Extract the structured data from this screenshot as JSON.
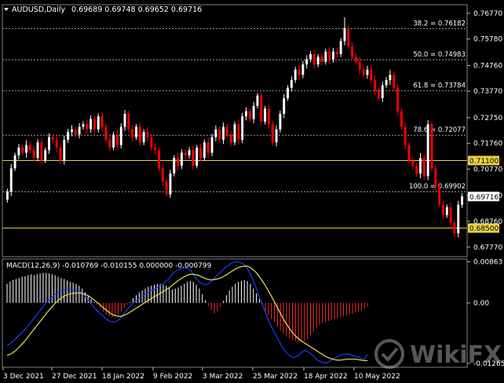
{
  "header": {
    "symbol": "AUDUSD,Daily",
    "ohlc": "0.69689 0.69748 0.69652 0.69716"
  },
  "macd_header": "MACD(12,26,9) -0.010769 -0.010155 0.000000 -0.000799",
  "watermark": "WikiFX",
  "colors": {
    "background": "#000000",
    "bull": "#ffffff",
    "bear": "#ff0000",
    "grid": "#c8c8c8",
    "sr_line": "#e8d24a",
    "macd_line": "#1a3cff",
    "signal_line": "#e8e05a",
    "hist_up": "#ffffff",
    "hist_down": "#ff2a2a"
  },
  "chart_data": {
    "type": "candlestick",
    "price_axis": {
      "ticks": [
        "0.76770",
        "0.75780",
        "0.74760",
        "0.73770",
        "0.72750",
        "0.71760",
        "0.70770",
        "0.69750",
        "0.68760",
        "0.67770"
      ],
      "range": [
        0.674,
        0.771
      ]
    },
    "date_axis": [
      "3 Dec 2021",
      "27 Dec 2021",
      "18 Jan 2022",
      "9 Feb 2022",
      "3 Mar 2022",
      "25 Mar 2022",
      "18 Apr 2022",
      "10 May 2022"
    ],
    "fib_levels": [
      {
        "label": "38.2 = 0.76182",
        "value": 0.76182
      },
      {
        "label": "50.0 = 0.74983",
        "value": 0.74983
      },
      {
        "label": "61.8 = 0.73784",
        "value": 0.73784
      },
      {
        "label": "78.6 = 0.72077",
        "value": 0.72077
      },
      {
        "label": "100.0 = 0.69902",
        "value": 0.69902
      }
    ],
    "sr_levels": [
      {
        "label": "0.71100",
        "value": 0.711
      },
      {
        "label": "0.68500",
        "value": 0.685
      }
    ],
    "current_price": {
      "label": "0.69716",
      "value": 0.69716
    },
    "closes": [
      0.699,
      0.708,
      0.713,
      0.716,
      0.714,
      0.717,
      0.715,
      0.712,
      0.718,
      0.711,
      0.715,
      0.72,
      0.719,
      0.716,
      0.711,
      0.719,
      0.722,
      0.723,
      0.721,
      0.724,
      0.725,
      0.723,
      0.727,
      0.723,
      0.728,
      0.724,
      0.719,
      0.716,
      0.721,
      0.717,
      0.724,
      0.729,
      0.723,
      0.72,
      0.724,
      0.718,
      0.722,
      0.72,
      0.716,
      0.715,
      0.708,
      0.703,
      0.698,
      0.706,
      0.712,
      0.709,
      0.714,
      0.713,
      0.715,
      0.709,
      0.716,
      0.712,
      0.718,
      0.714,
      0.72,
      0.723,
      0.719,
      0.724,
      0.721,
      0.718,
      0.725,
      0.719,
      0.728,
      0.73,
      0.727,
      0.732,
      0.736,
      0.726,
      0.731,
      0.725,
      0.718,
      0.723,
      0.729,
      0.735,
      0.739,
      0.742,
      0.746,
      0.744,
      0.748,
      0.75,
      0.752,
      0.748,
      0.751,
      0.749,
      0.753,
      0.75,
      0.753,
      0.752,
      0.757,
      0.762,
      0.755,
      0.751,
      0.749,
      0.746,
      0.744,
      0.746,
      0.742,
      0.738,
      0.735,
      0.74,
      0.742,
      0.744,
      0.739,
      0.73,
      0.724,
      0.717,
      0.711,
      0.709,
      0.706,
      0.712,
      0.705,
      0.725,
      0.708,
      0.701,
      0.694,
      0.69,
      0.693,
      0.687,
      0.683,
      0.694,
      0.6972
    ],
    "macd_axis": {
      "ticks": [
        "0.00863",
        "0.00",
        "-0.012657"
      ],
      "range": [
        -0.0135,
        0.0092
      ]
    },
    "macd_hist": [
      0.004,
      0.0045,
      0.0048,
      0.005,
      0.0052,
      0.0055,
      0.0056,
      0.0058,
      0.006,
      0.0058,
      0.006,
      0.0062,
      0.0063,
      0.0063,
      0.0062,
      0.006,
      0.0058,
      0.0055,
      0.0052,
      0.005,
      0.0047,
      0.0044,
      0.0042,
      0.004,
      0.0036,
      0.003,
      0.0022,
      0.0015,
      0.0008,
      0.0002,
      -0.0004,
      -0.001,
      -0.0018,
      -0.0024,
      -0.0028,
      -0.003,
      -0.0028,
      -0.0024,
      -0.0018,
      -0.001,
      -0.0004,
      0.0002,
      0.001,
      0.0016,
      0.0022,
      0.0026,
      0.003,
      0.0034,
      0.0036,
      0.0038,
      0.004,
      0.004,
      0.0038,
      0.0036,
      0.0032,
      0.0028,
      0.003,
      0.0032,
      0.0036,
      0.004,
      0.0044,
      0.0046,
      0.0044,
      0.0038,
      0.003,
      0.0018,
      0.0006,
      -0.0006,
      -0.0016,
      -0.0022,
      -0.0018,
      -0.0008,
      0.0004,
      0.0016,
      0.0026,
      0.0034,
      0.004,
      0.0044,
      0.0046,
      0.0048,
      0.0046,
      0.004,
      0.003,
      0.002,
      0.0008,
      -0.0004,
      -0.0016,
      -0.0026,
      -0.0034,
      -0.004,
      -0.005,
      -0.0058,
      -0.0065,
      -0.007,
      -0.0075,
      -0.0078,
      -0.008,
      -0.0082,
      -0.0082,
      -0.008,
      -0.0076,
      -0.0068,
      -0.006,
      -0.0052,
      -0.0046,
      -0.0042,
      -0.004,
      -0.0038,
      -0.0036,
      -0.0034,
      -0.0032,
      -0.003,
      -0.0028,
      -0.0026,
      -0.0024,
      -0.0022,
      -0.002,
      -0.0018,
      -0.0016,
      -0.0012,
      -0.0008
    ],
    "macd_line": [
      -0.009,
      -0.0085,
      -0.008,
      -0.0074,
      -0.0068,
      -0.0062,
      -0.0056,
      -0.0048,
      -0.004,
      -0.0032,
      -0.0024,
      -0.0016,
      -0.0008,
      0.0,
      0.0006,
      0.0012,
      0.0018,
      0.0022,
      0.0025,
      0.0027,
      0.0028,
      0.0028,
      0.0027,
      0.0026,
      0.0024,
      0.002,
      0.0014,
      0.0006,
      -0.0002,
      -0.001,
      -0.0016,
      -0.0022,
      -0.0028,
      -0.0034,
      -0.0038,
      -0.004,
      -0.004,
      -0.0036,
      -0.003,
      -0.0022,
      -0.0014,
      -0.0006,
      0.0,
      0.0005,
      0.001,
      0.0014,
      0.0018,
      0.0022,
      0.0026,
      0.0029,
      0.0032,
      0.0036,
      0.004,
      0.0045,
      0.0052,
      0.006,
      0.0066,
      0.007,
      0.0072,
      0.0074,
      0.0072,
      0.0068,
      0.006,
      0.005,
      0.0044,
      0.004,
      0.0038,
      0.004,
      0.0046,
      0.0052,
      0.0058,
      0.0064,
      0.007,
      0.0076,
      0.008,
      0.0084,
      0.0086,
      0.0086,
      0.0084,
      0.008,
      0.0072,
      0.006,
      0.0046,
      0.003,
      0.0012,
      -0.0004,
      -0.002,
      -0.0036,
      -0.005,
      -0.0062,
      -0.0074,
      -0.0086,
      -0.0096,
      -0.0104,
      -0.011,
      -0.0114,
      -0.0114,
      -0.011,
      -0.0104,
      -0.01,
      -0.0102,
      -0.0106,
      -0.0112,
      -0.0118,
      -0.0122,
      -0.0125,
      -0.0126,
      -0.0124,
      -0.012,
      -0.0116,
      -0.0112,
      -0.011,
      -0.0108,
      -0.0107,
      -0.0108,
      -0.011,
      -0.0112,
      -0.0114,
      -0.0116,
      -0.0118,
      -0.0108
    ],
    "signal_line": [
      -0.011,
      -0.0108,
      -0.0104,
      -0.0099,
      -0.0093,
      -0.0086,
      -0.0079,
      -0.0071,
      -0.0063,
      -0.0055,
      -0.0047,
      -0.0039,
      -0.0031,
      -0.0023,
      -0.0015,
      -0.0008,
      -0.0001,
      0.0005,
      0.001,
      0.0014,
      0.0017,
      0.0019,
      0.002,
      0.0021,
      0.0021,
      0.002,
      0.0018,
      0.0015,
      0.0011,
      0.0006,
      0.0001,
      -0.0004,
      -0.001,
      -0.0015,
      -0.002,
      -0.0024,
      -0.0027,
      -0.0028,
      -0.0028,
      -0.0026,
      -0.0023,
      -0.0019,
      -0.0015,
      -0.0011,
      -0.0007,
      -0.0003,
      0.0001,
      0.0005,
      0.0009,
      0.0013,
      0.0016,
      0.002,
      0.0024,
      0.0028,
      0.0032,
      0.0037,
      0.0042,
      0.0047,
      0.0051,
      0.0055,
      0.0058,
      0.006,
      0.006,
      0.0059,
      0.0057,
      0.0054,
      0.0051,
      0.0049,
      0.0048,
      0.0049,
      0.005,
      0.0052,
      0.0055,
      0.0059,
      0.0063,
      0.0067,
      0.0071,
      0.0074,
      0.0076,
      0.0077,
      0.0077,
      0.0074,
      0.0069,
      0.0063,
      0.0055,
      0.0046,
      0.0036,
      0.0025,
      0.0014,
      0.0002,
      -0.001,
      -0.0022,
      -0.0034,
      -0.0044,
      -0.0054,
      -0.0062,
      -0.0069,
      -0.0075,
      -0.008,
      -0.0084,
      -0.0088,
      -0.0092,
      -0.0096,
      -0.01,
      -0.0104,
      -0.0108,
      -0.0112,
      -0.0115,
      -0.0117,
      -0.0119,
      -0.012,
      -0.012,
      -0.0119,
      -0.0118,
      -0.0118,
      -0.0118,
      -0.0118,
      -0.0119,
      -0.012,
      -0.0121,
      -0.0121
    ]
  }
}
